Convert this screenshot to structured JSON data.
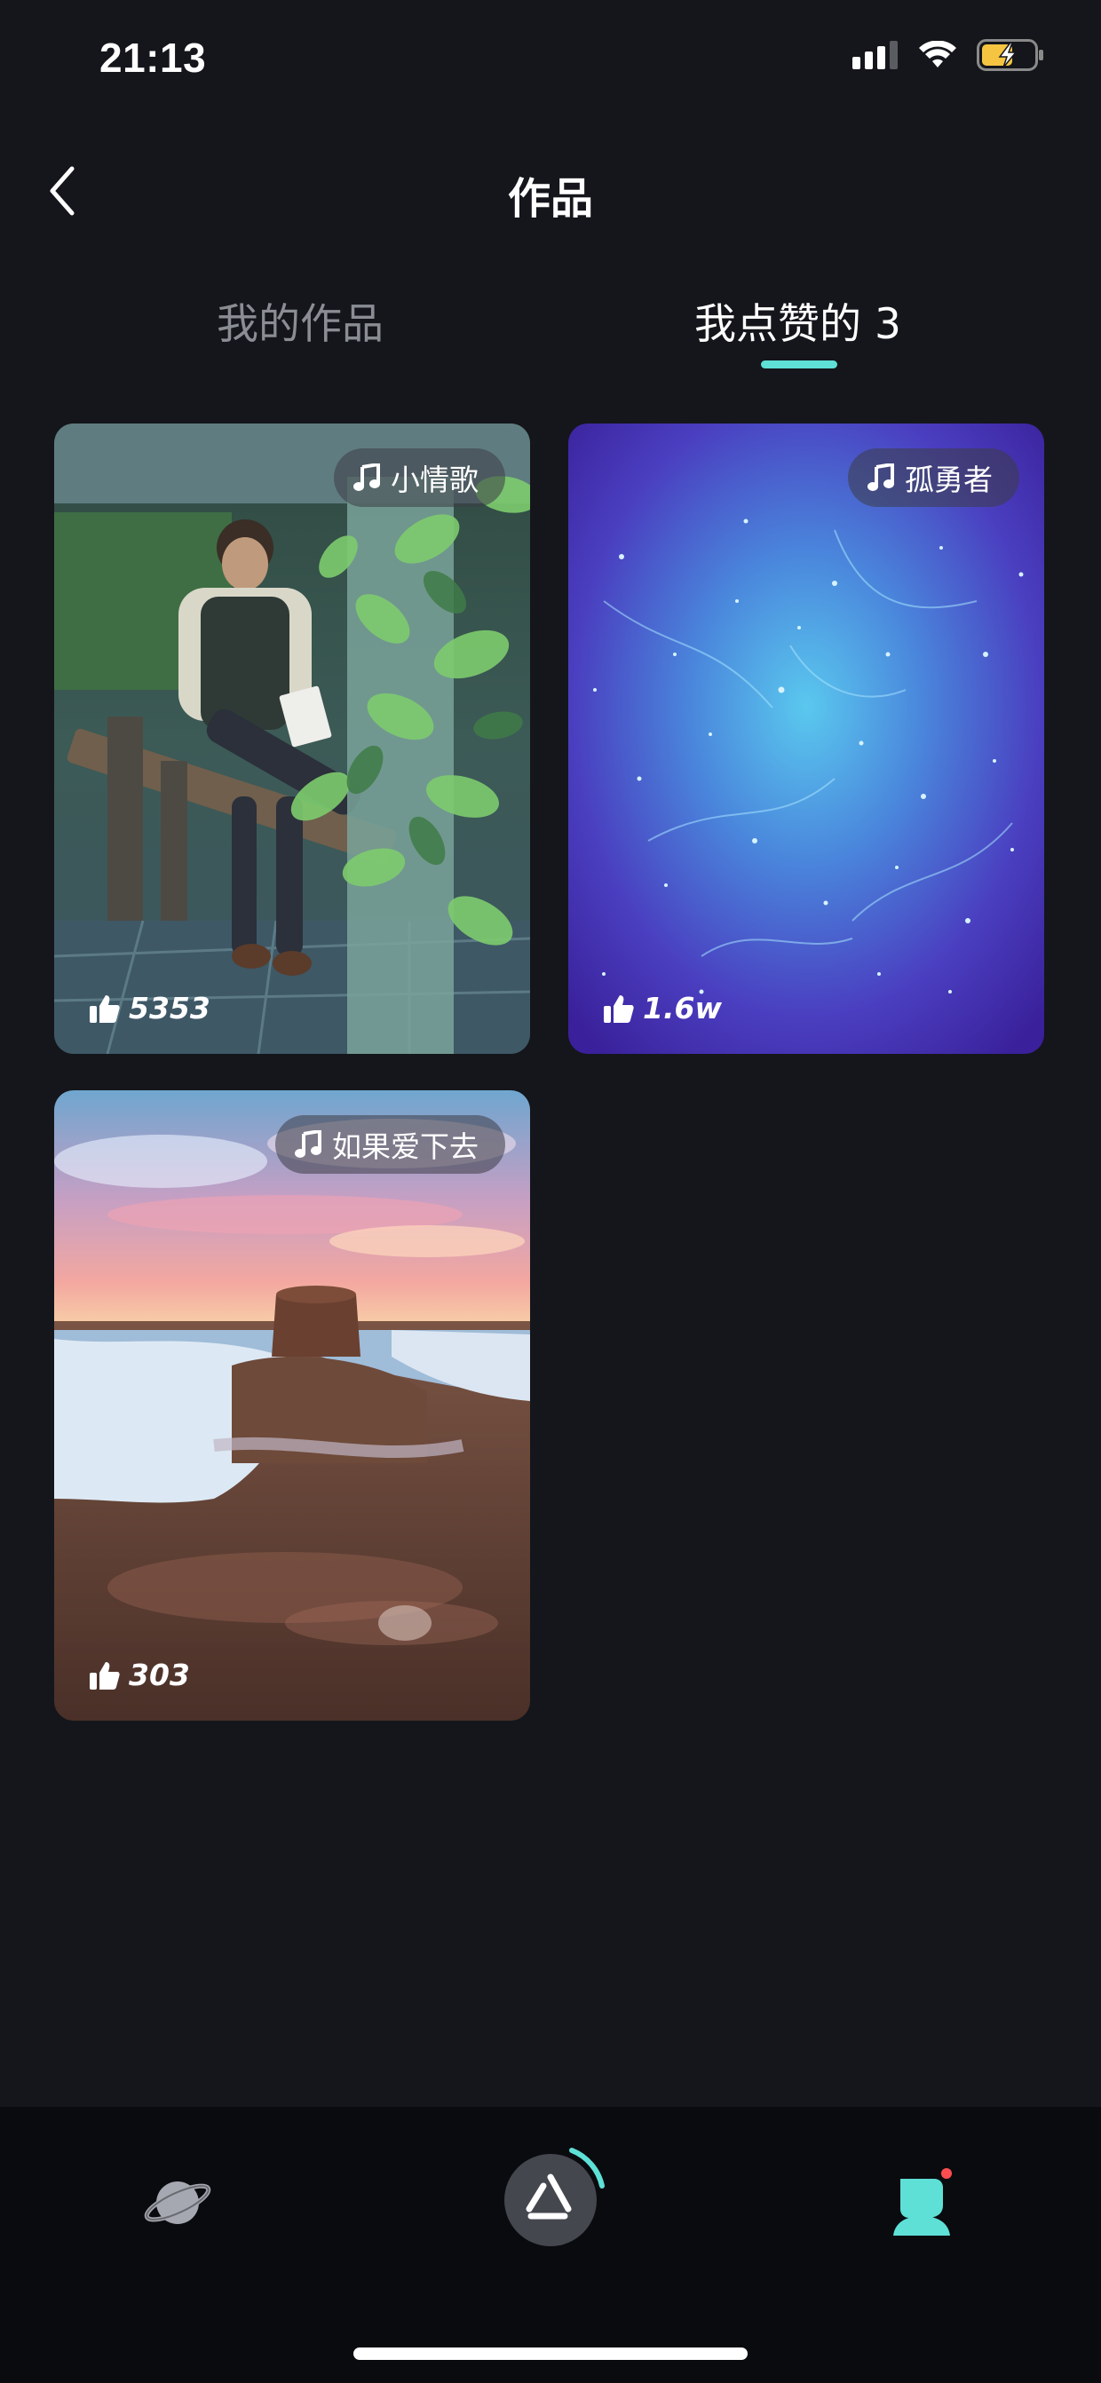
{
  "status_bar": {
    "time": "21:13",
    "icons": [
      "signal-icon",
      "wifi-icon",
      "battery-charging-icon"
    ]
  },
  "nav": {
    "title": "作品",
    "back_icon": "chevron-left-icon"
  },
  "tabs": [
    {
      "label": "我的作品",
      "active": false
    },
    {
      "label": "我点赞的 3",
      "active": true
    }
  ],
  "cards": [
    {
      "music": "小情歌",
      "likes": "5353",
      "scene": "anime-boy-bench"
    },
    {
      "music": "孤勇者",
      "likes": "1.6w",
      "scene": "purple-nebula"
    },
    {
      "music": "如果爱下去",
      "likes": "303",
      "scene": "sunset-beach-sandcastle"
    }
  ],
  "bottom_nav": {
    "items": [
      "planet-icon",
      "create-logo-icon",
      "profile-icon"
    ],
    "profile_has_badge": true
  },
  "colors": {
    "background": "#14161b",
    "accent": "#5ee0d6",
    "inactive_tab": "#8a8d93",
    "badge": "#ff4d4f"
  }
}
